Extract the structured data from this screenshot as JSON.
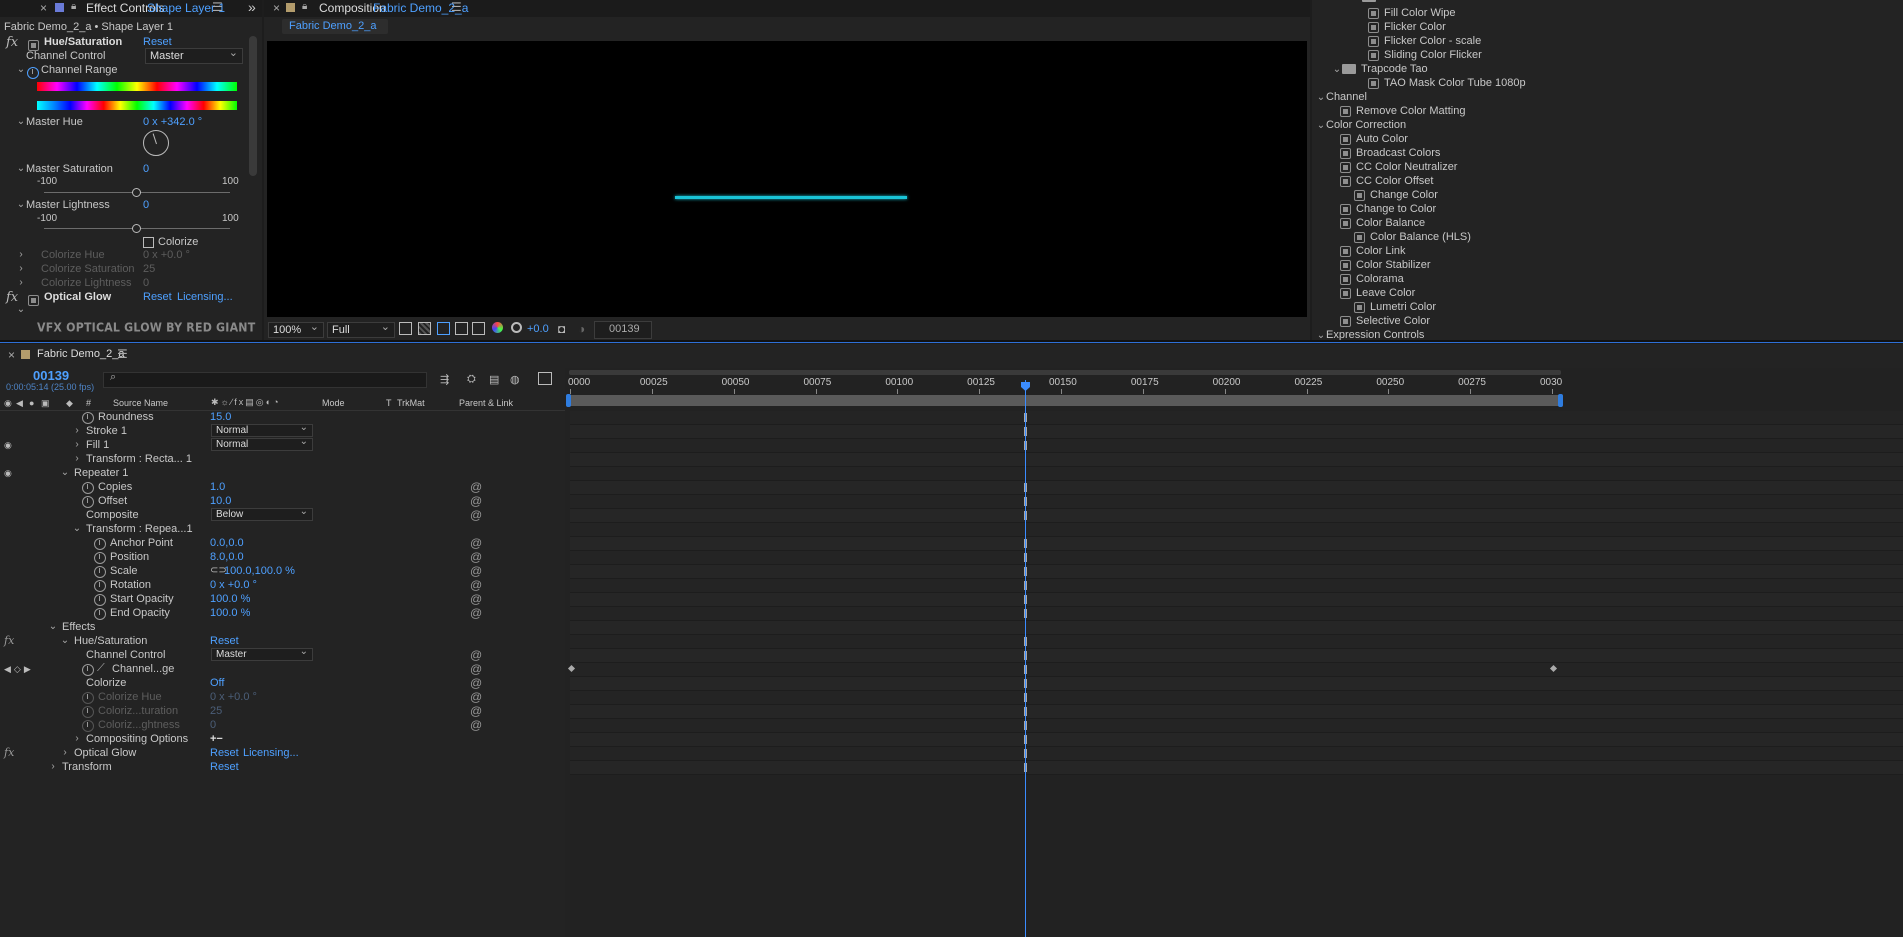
{
  "effect_controls": {
    "tab_close": "×",
    "tab_label": "Effect Controls",
    "tab_layer": "Shape Layer 1",
    "expand": "»",
    "breadcrumb": "Fabric Demo_2_a • Shape Layer 1",
    "hue_sat": {
      "fx": "fx",
      "name": "Hue/Saturation",
      "reset": "Reset"
    },
    "channel_control_label": "Channel Control",
    "channel_control_value": "Master",
    "channel_range_label": "Channel Range",
    "master_hue_label": "Master Hue",
    "master_hue_value": "0 x +342.0 °",
    "master_sat_label": "Master Saturation",
    "master_sat_value": "0",
    "sat_min": "-100",
    "sat_max": "100",
    "master_light_label": "Master Lightness",
    "master_light_value": "0",
    "light_min": "-100",
    "light_max": "100",
    "colorize_label": "Colorize",
    "colorize_hue_label": "Colorize Hue",
    "colorize_hue_value": "0 x +0.0 °",
    "colorize_sat_label": "Colorize Saturation",
    "colorize_sat_value": "25",
    "colorize_light_label": "Colorize Lightness",
    "colorize_light_value": "0",
    "optical_glow": {
      "fx": "fx",
      "name": "Optical Glow",
      "reset": "Reset",
      "licensing": "Licensing..."
    },
    "banner": "VFX OPTICAL GLOW BY RED GIANT"
  },
  "composition": {
    "tab_close": "×",
    "tab_prefix": "Composition",
    "tab_name": "Fabric Demo_2_a",
    "sub_tab": "Fabric Demo_2_a",
    "zoom": "100%",
    "resolution": "Full",
    "exposure": "+0.0",
    "timecode": "00139",
    "glow_color": "#19c3d6"
  },
  "effects_presets": {
    "items": [
      {
        "type": "effect",
        "label": "Fill Color Wipe",
        "indent": 3
      },
      {
        "type": "effect",
        "label": "Flicker Color",
        "indent": 3
      },
      {
        "type": "effect",
        "label": "Flicker Color - scale",
        "indent": 3
      },
      {
        "type": "effect",
        "label": "Sliding Color Flicker",
        "indent": 3
      },
      {
        "type": "folder",
        "label": "Trapcode Tao",
        "indent": 2
      },
      {
        "type": "effect",
        "label": "TAO Mask Color Tube 1080p",
        "indent": 3
      },
      {
        "type": "category",
        "label": "Channel",
        "indent": 0
      },
      {
        "type": "effect",
        "label": "Remove Color Matting",
        "indent": 1
      },
      {
        "type": "category",
        "label": "Color Correction",
        "indent": 0
      },
      {
        "type": "effect",
        "label": "Auto Color",
        "indent": 1
      },
      {
        "type": "effect",
        "label": "Broadcast Colors",
        "indent": 1
      },
      {
        "type": "effect",
        "label": "CC Color Neutralizer",
        "indent": 1
      },
      {
        "type": "effect",
        "label": "CC Color Offset",
        "indent": 1
      },
      {
        "type": "effect",
        "label": "Change Color",
        "indent": 2
      },
      {
        "type": "effect",
        "label": "Change to Color",
        "indent": 1
      },
      {
        "type": "effect",
        "label": "Color Balance",
        "indent": 1
      },
      {
        "type": "effect",
        "label": "Color Balance (HLS)",
        "indent": 2
      },
      {
        "type": "effect",
        "label": "Color Link",
        "indent": 1
      },
      {
        "type": "effect",
        "label": "Color Stabilizer",
        "indent": 1
      },
      {
        "type": "effect",
        "label": "Colorama",
        "indent": 1
      },
      {
        "type": "effect",
        "label": "Leave Color",
        "indent": 1
      },
      {
        "type": "effect",
        "label": "Lumetri Color",
        "indent": 2
      },
      {
        "type": "effect",
        "label": "Selective Color",
        "indent": 1
      },
      {
        "type": "category",
        "label": "Expression Controls",
        "indent": 0
      }
    ]
  },
  "timeline": {
    "tab_close": "×",
    "tab_name": "Fabric Demo_2_a",
    "current_frame": "00139",
    "timecode": "0:00:05:14 (25.00 fps)",
    "columns": {
      "source_name": "Source Name",
      "mode": "Mode",
      "t": "T",
      "trkmat": "TrkMat",
      "parent": "Parent & Link",
      "hash": "#"
    },
    "ruler": [
      "0000",
      "00025",
      "00050",
      "00075",
      "00100",
      "00125",
      "00150",
      "00175",
      "00200",
      "00225",
      "00250",
      "00275",
      "0030"
    ],
    "playhead_frame": 139,
    "rows": [
      {
        "label": "Roundness",
        "indent": 7,
        "stopwatch": true,
        "value": "15.0"
      },
      {
        "label": "Stroke 1",
        "indent": 6,
        "chevron": "›",
        "mode": "Normal",
        "eye": false
      },
      {
        "label": "Fill 1",
        "indent": 6,
        "chevron": "›",
        "mode": "Normal",
        "eye": true
      },
      {
        "label": "Transform : Recta... 1",
        "indent": 6,
        "chevron": "›"
      },
      {
        "label": "Repeater 1",
        "indent": 5,
        "chevron": "⌄",
        "eye": true
      },
      {
        "label": "Copies",
        "indent": 7,
        "stopwatch": true,
        "value": "1.0",
        "spiral": true
      },
      {
        "label": "Offset",
        "indent": 7,
        "stopwatch": true,
        "value": "10.0",
        "spiral": true
      },
      {
        "label": "Composite",
        "indent": 6,
        "mode": "Below",
        "spiral": true
      },
      {
        "label": "Transform : Repea...1",
        "indent": 6,
        "chevron": "⌄"
      },
      {
        "label": "Anchor Point",
        "indent": 8,
        "stopwatch": true,
        "value": "0.0,0.0",
        "spiral": true
      },
      {
        "label": "Position",
        "indent": 8,
        "stopwatch": true,
        "value": "8.0,0.0",
        "spiral": true
      },
      {
        "label": "Scale",
        "indent": 8,
        "stopwatch": true,
        "value": "100.0,100.0 %",
        "link": true,
        "spiral": true
      },
      {
        "label": "Rotation",
        "indent": 8,
        "stopwatch": true,
        "value": "0 x +0.0 °",
        "spiral": true
      },
      {
        "label": "Start Opacity",
        "indent": 8,
        "stopwatch": true,
        "value": "100.0 %",
        "spiral": true
      },
      {
        "label": "End Opacity",
        "indent": 8,
        "stopwatch": true,
        "value": "100.0 %",
        "spiral": true
      },
      {
        "label": "Effects",
        "indent": 4,
        "chevron": "⌄"
      },
      {
        "label": "Hue/Saturation",
        "indent": 5,
        "chevron": "⌄",
        "value": "Reset",
        "fx": true
      },
      {
        "label": "Channel Control",
        "indent": 6,
        "mode": "Master",
        "spiral": true
      },
      {
        "label": "Channel...ge",
        "indent": 7,
        "stopwatch": true,
        "graph": true,
        "spiral": true,
        "kfnav": true
      },
      {
        "label": "Colorize",
        "indent": 6,
        "value": "Off",
        "spiral": true
      },
      {
        "label": "Colorize Hue",
        "indent": 7,
        "stopwatch": true,
        "value": "0 x +0.0 °",
        "dim": true,
        "spiral": true
      },
      {
        "label": "Coloriz...turation",
        "indent": 7,
        "stopwatch": true,
        "value": "25",
        "dim": true,
        "spiral": true
      },
      {
        "label": "Coloriz...ghtness",
        "indent": 7,
        "stopwatch": true,
        "value": "0",
        "dim": true,
        "spiral": true
      },
      {
        "label": "Compositing Options",
        "indent": 6,
        "chevron": "›",
        "value": "+−"
      },
      {
        "label": "Optical Glow",
        "indent": 5,
        "chevron": "›",
        "value": "Reset",
        "licensing": "Licensing...",
        "fx": true
      },
      {
        "label": "Transform",
        "indent": 4,
        "chevron": "›",
        "value": "Reset"
      }
    ]
  }
}
